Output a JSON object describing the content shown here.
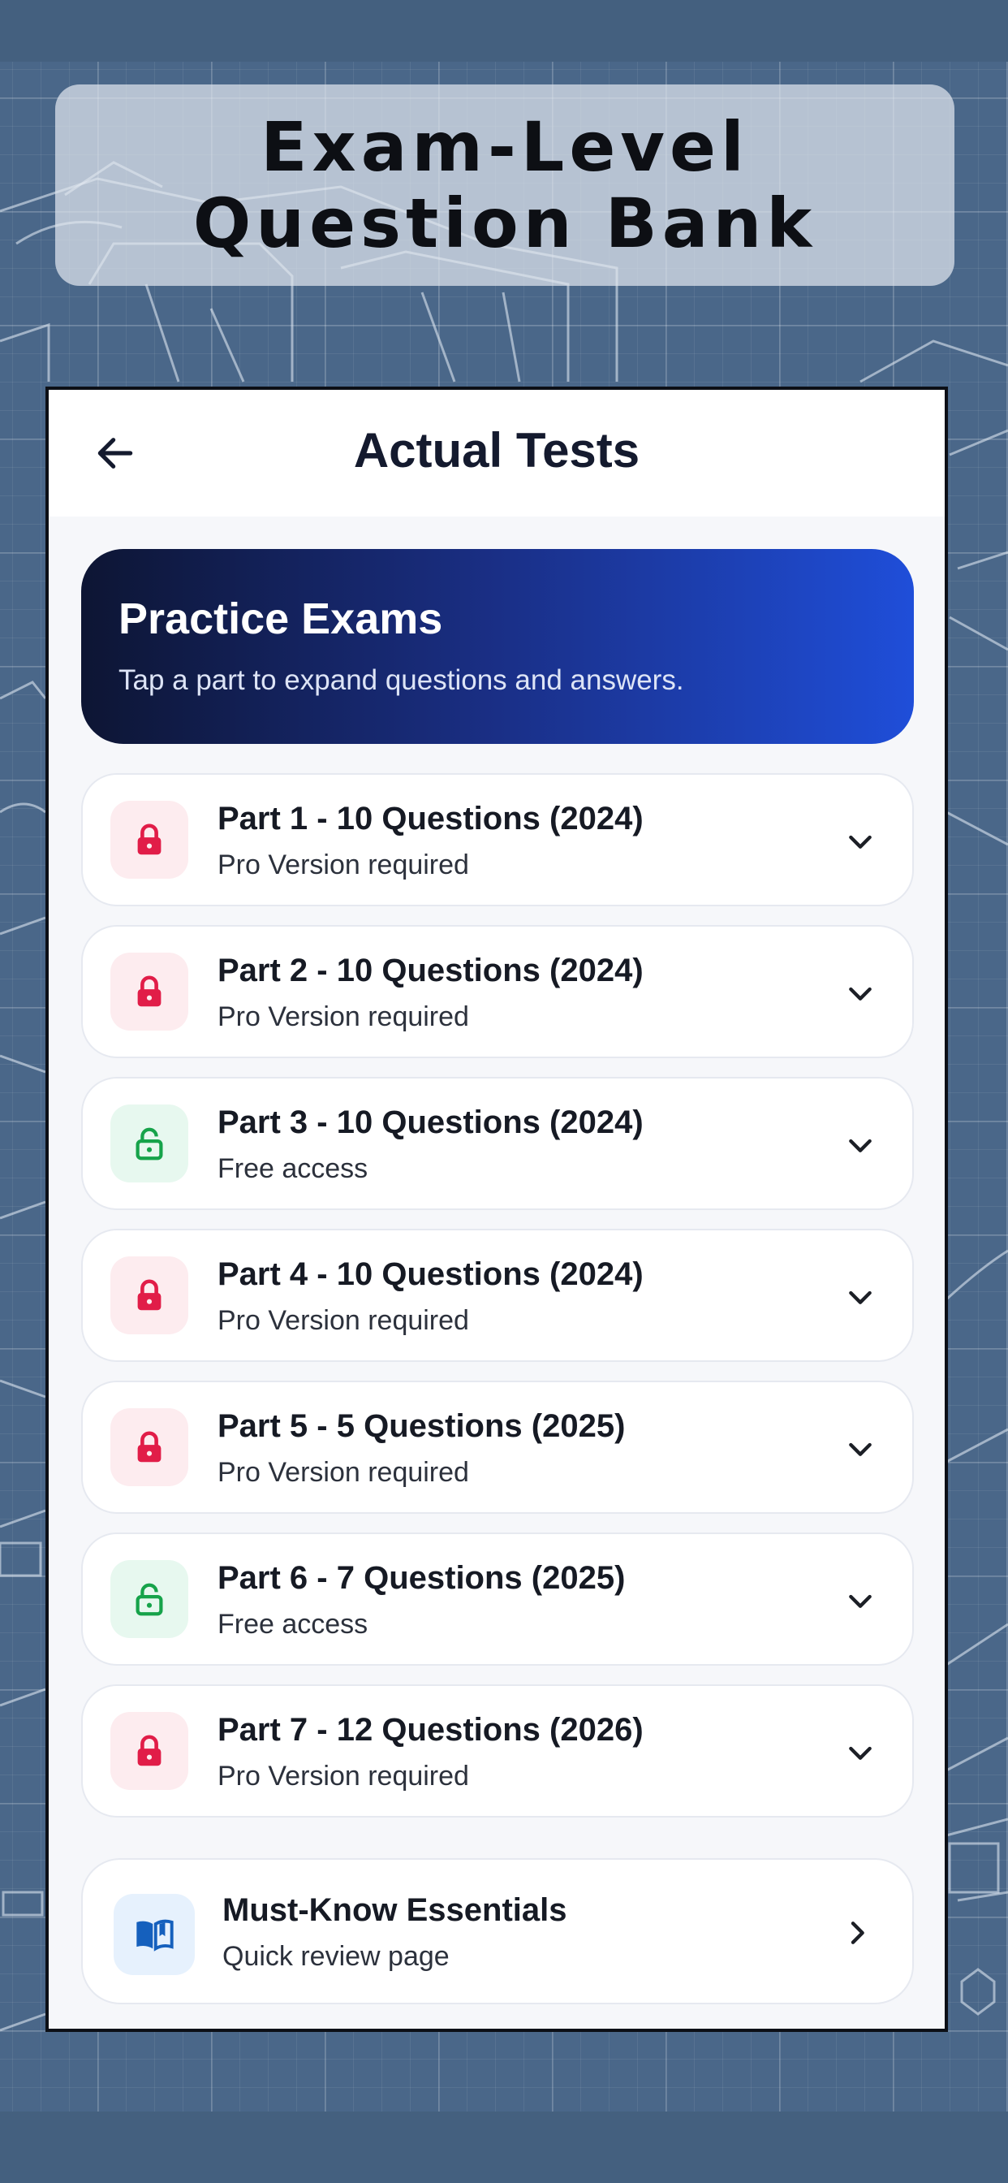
{
  "banner": {
    "title_line1": "Exam-Level",
    "title_line2": "Question Bank"
  },
  "appbar": {
    "title": "Actual Tests",
    "back_icon": "arrow-left-icon"
  },
  "hero": {
    "title": "Practice Exams",
    "subtitle": "Tap a part to expand questions and answers."
  },
  "parts": [
    {
      "title": "Part 1 - 10 Questions (2024)",
      "status": "Pro Version required",
      "locked": true
    },
    {
      "title": "Part 2 - 10 Questions (2024)",
      "status": "Pro Version required",
      "locked": true
    },
    {
      "title": "Part 3 - 10 Questions (2024)",
      "status": "Free access",
      "locked": false
    },
    {
      "title": "Part 4 - 10 Questions (2024)",
      "status": "Pro Version required",
      "locked": true
    },
    {
      "title": "Part 5 - 5 Questions (2025)",
      "status": "Pro Version required",
      "locked": true
    },
    {
      "title": "Part 6 - 7 Questions (2025)",
      "status": "Free access",
      "locked": false
    },
    {
      "title": "Part 7 - 12 Questions (2026)",
      "status": "Pro Version required",
      "locked": true
    }
  ],
  "essentials": {
    "title": "Must-Know Essentials",
    "subtitle": "Quick review page",
    "icon": "open-book-icon"
  },
  "colors": {
    "locked_accent": "#e11d48",
    "free_accent": "#16a34a",
    "book_accent": "#1560bd",
    "hero_gradient_start": "#0d1533",
    "hero_gradient_end": "#1f4ed9"
  }
}
